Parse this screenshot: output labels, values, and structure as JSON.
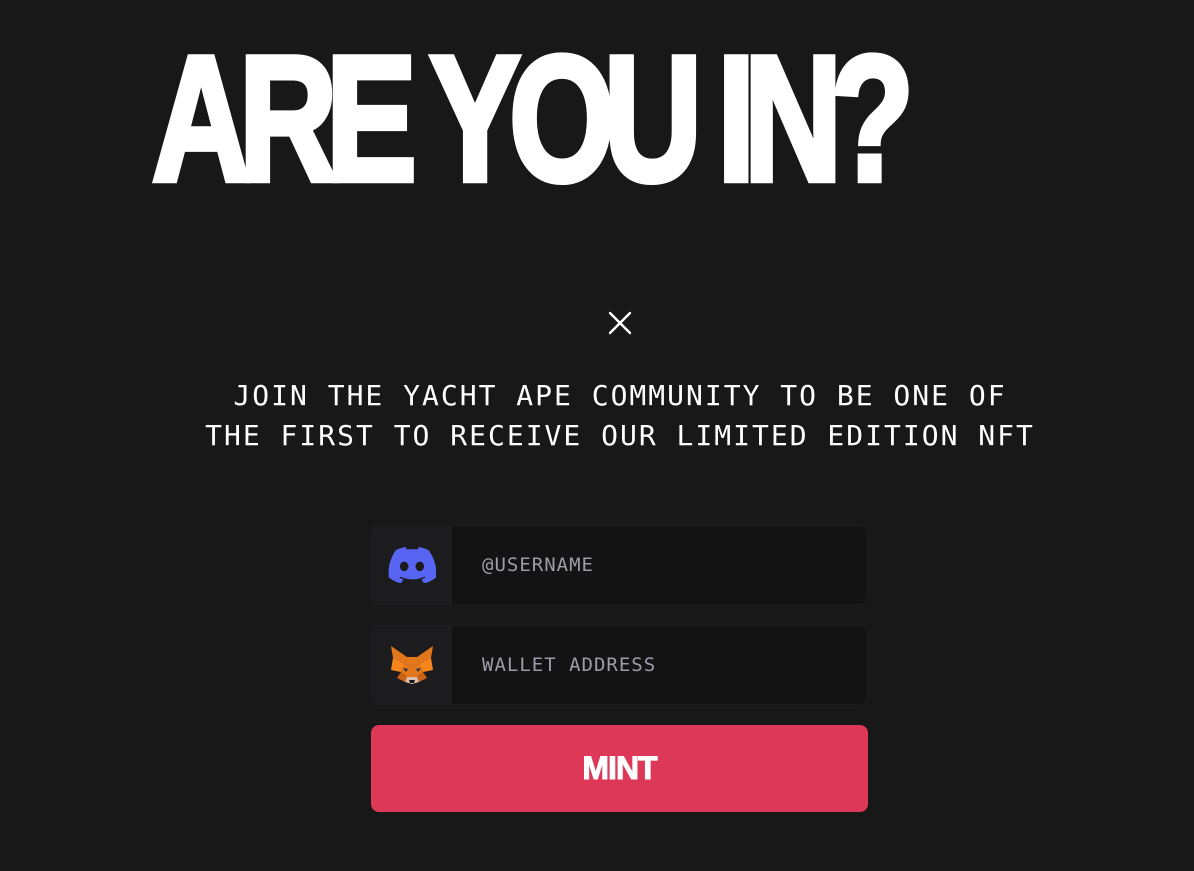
{
  "headline": "ARE YOU IN?",
  "tagline": "JOIN THE YACHT APE COMMUNITY TO BE ONE OF THE FIRST TO RECEIVE OUR LIMITED EDITION NFT",
  "close_icon": "close-icon",
  "form": {
    "discord": {
      "icon": "discord-icon",
      "placeholder": "@USERNAME",
      "value": ""
    },
    "wallet": {
      "icon": "metamask-fox-icon",
      "placeholder": "WALLET ADDRESS",
      "value": ""
    },
    "mint_label": "MINT"
  },
  "colors": {
    "background": "#181818",
    "text": "#ffffff",
    "accent": "#dd3858",
    "discord": "#5865f2",
    "metamask": "#e2761b",
    "placeholder": "#9d9da6"
  }
}
